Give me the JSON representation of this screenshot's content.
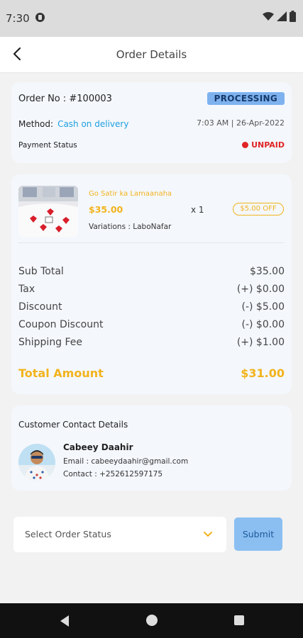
{
  "status_bar": {
    "time": "7:30"
  },
  "appbar": {
    "title": "Order Details"
  },
  "order": {
    "order_no": "Order No : #100003",
    "status": "PROCESSING",
    "method_label": "Method:",
    "method_value": "Cash on delivery",
    "datetime": "7:03 AM | 26-Apr-2022",
    "payment_status_label": "Payment Status",
    "payment_status": "UNPAID"
  },
  "item": {
    "name": "Go Satir ka Lamaanaha",
    "price": "$35.00",
    "quantity": "x 1",
    "discount": "$5.00 OFF",
    "variations": "Variations : LaboNafar"
  },
  "summary": [
    {
      "label": "Sub Total",
      "value": "$35.00"
    },
    {
      "label": "Tax",
      "value": "(+) $0.00"
    },
    {
      "label": "Discount",
      "value": "(-) $5.00"
    },
    {
      "label": "Coupon Discount",
      "value": "(-) $0.00"
    },
    {
      "label": "Shipping Fee",
      "value": "(+) $1.00"
    }
  ],
  "total": {
    "label": "Total Amount",
    "value": "$31.00"
  },
  "customer": {
    "section_title": "Customer Contact Details",
    "name": "Cabeey Daahir",
    "email": "Email : cabeeydaahir@gmail.com",
    "contact": "Contact : +252612597175"
  },
  "actions": {
    "select_placeholder": "Select Order Status",
    "submit_label": "Submit"
  },
  "colors": {
    "accent": "#f2b31c",
    "link": "#1ea0e0",
    "processing_badge": "#7eb2ef",
    "unpaid": "#e02424",
    "submit_bg": "#8bbff2"
  }
}
